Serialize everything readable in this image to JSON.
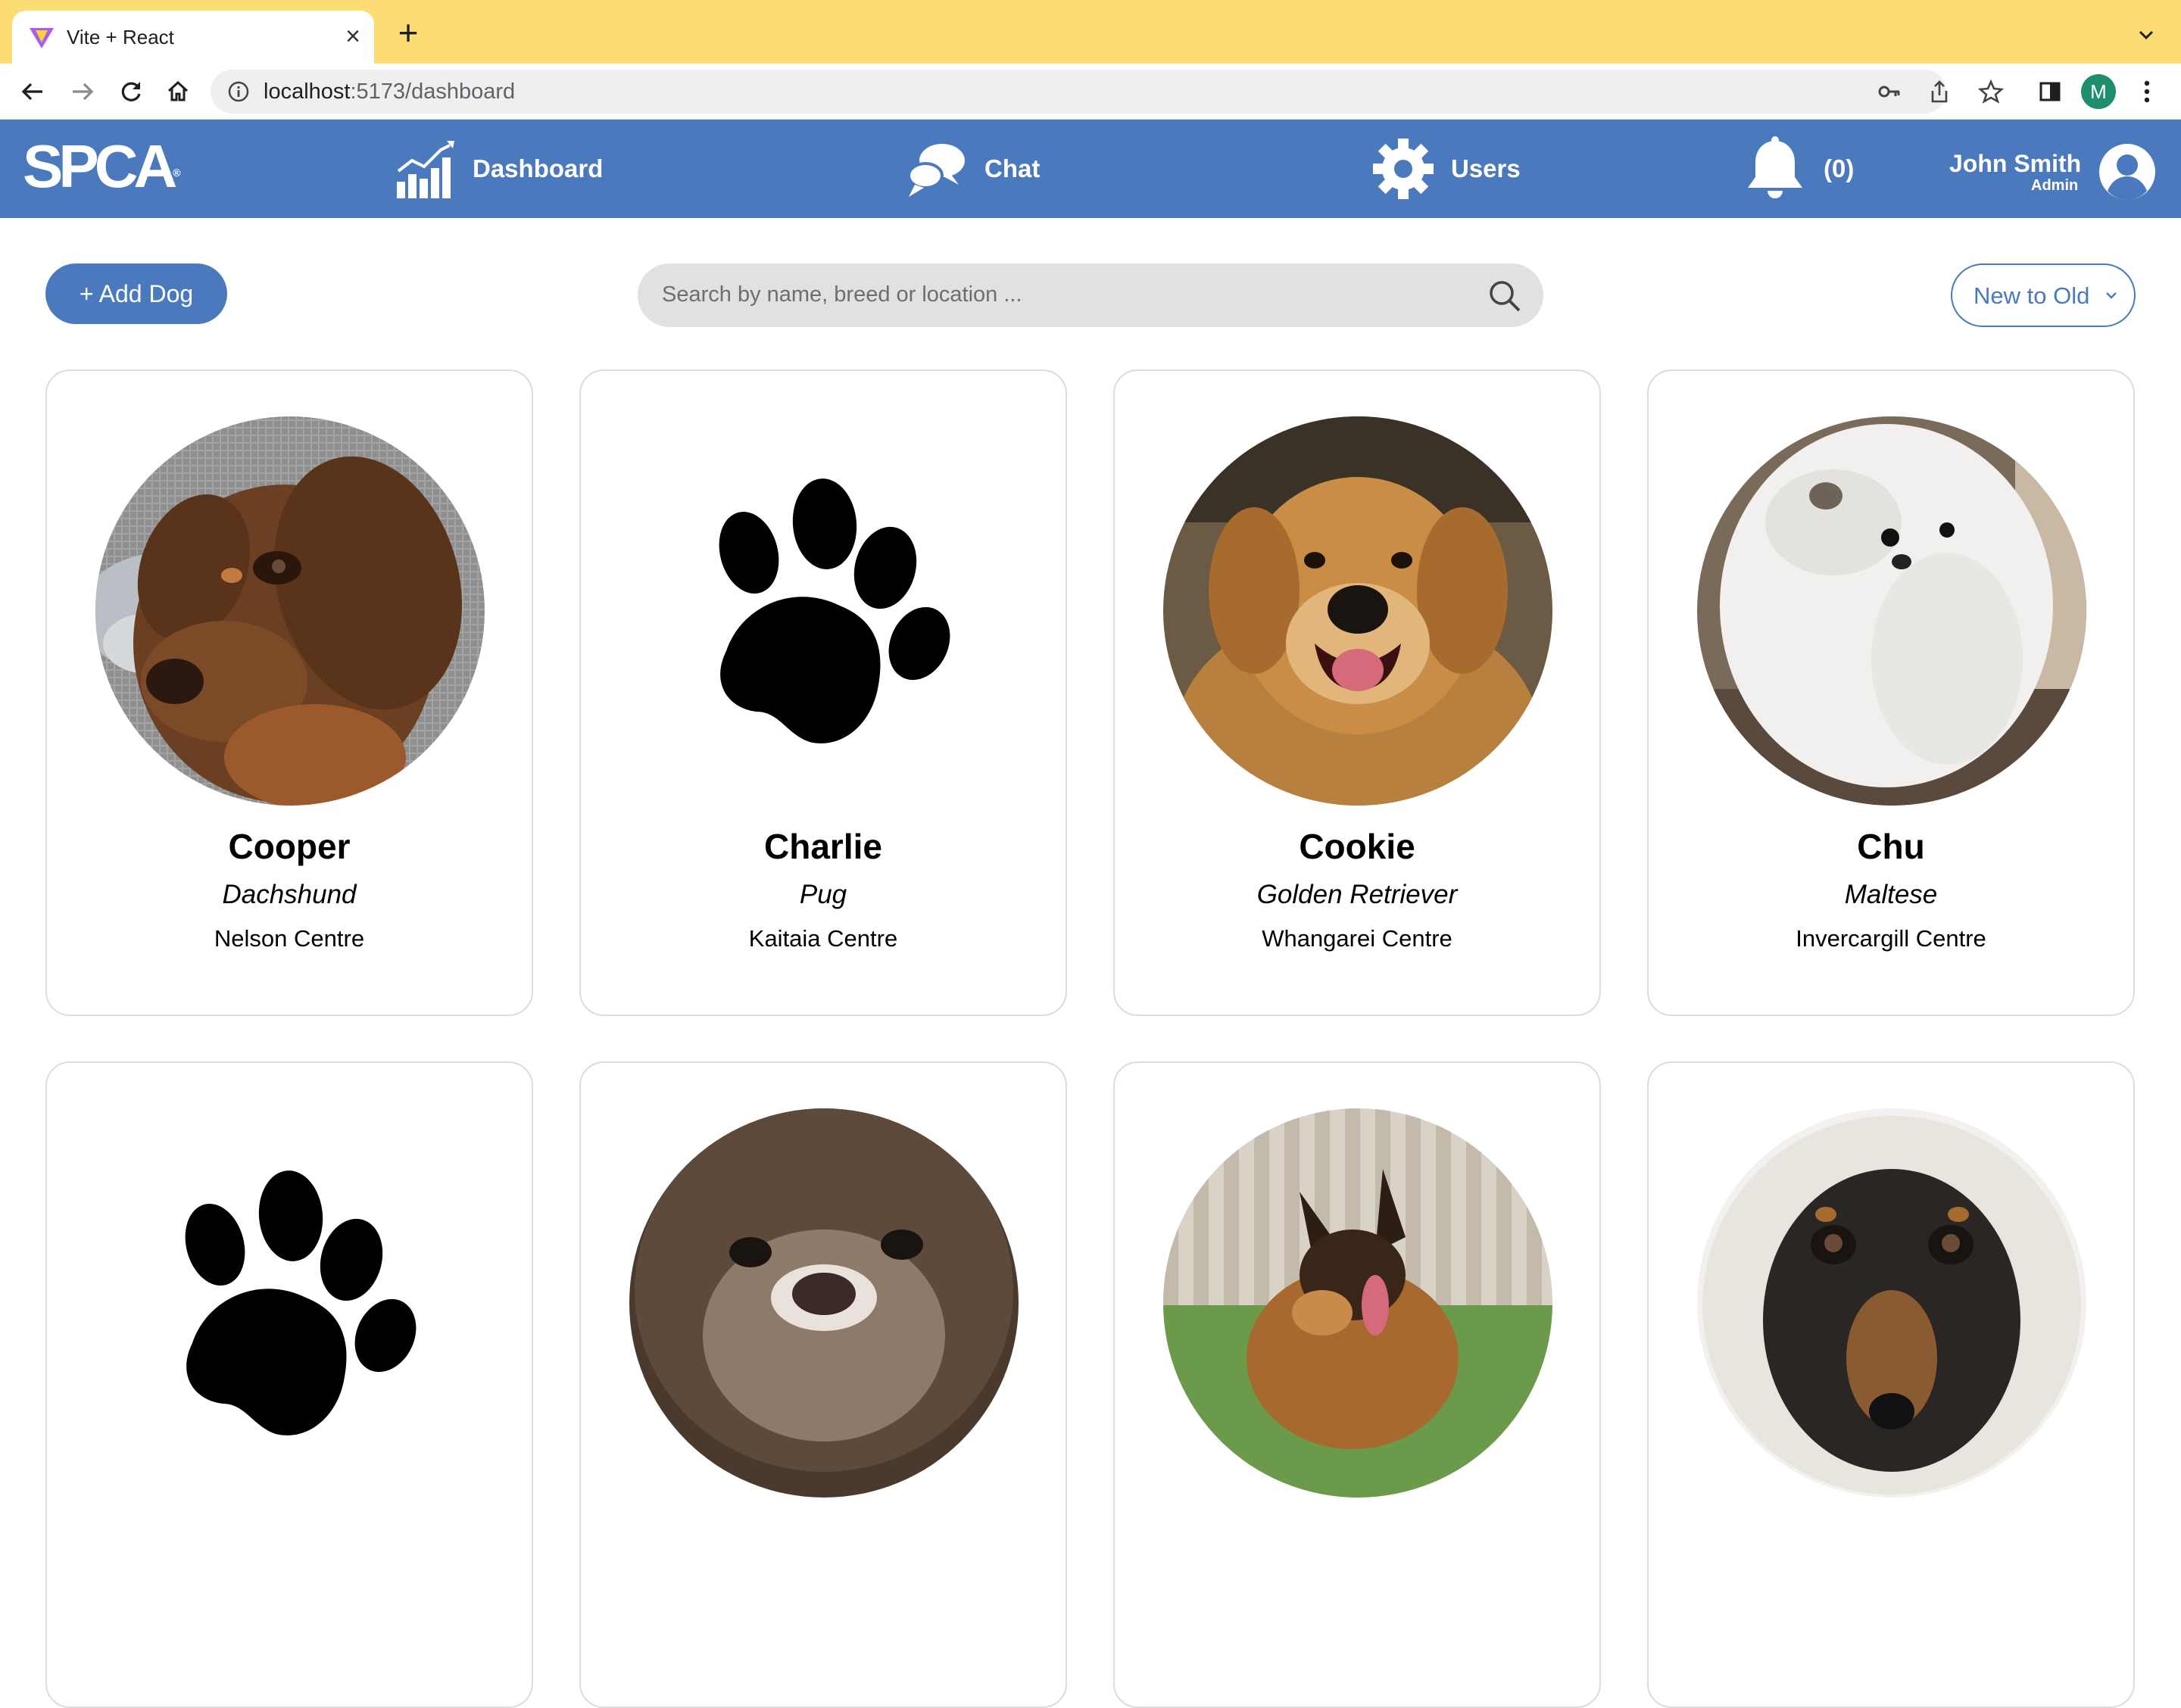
{
  "browser": {
    "tab_title": "Vite + React",
    "url_host": "localhost",
    "url_rest": ":5173/dashboard",
    "profile_initial": "M"
  },
  "nav": {
    "logo_text": "SPCA",
    "logo_mark": "®",
    "dashboard_label": "Dashboard",
    "chat_label": "Chat",
    "users_label": "Users",
    "notification_count": "(0)",
    "user_name": "John Smith",
    "user_role": "Admin"
  },
  "controls": {
    "add_dog_label": "+ Add Dog",
    "search_placeholder": "Search by name, breed or location ...",
    "sort_label": "New to Old"
  },
  "colors": {
    "brand": "#4b79be",
    "tabbar": "#fbdd74"
  },
  "dogs": [
    {
      "name": "Cooper",
      "breed": "Dachshund",
      "location": "Nelson Centre",
      "photo": "dachshund-photo"
    },
    {
      "name": "Charlie",
      "breed": "Pug",
      "location": "Kaitaia Centre",
      "photo": "paw-placeholder"
    },
    {
      "name": "Cookie",
      "breed": "Golden Retriever",
      "location": "Whangarei Centre",
      "photo": "golden-retriever-photo"
    },
    {
      "name": "Chu",
      "breed": "Maltese",
      "location": "Invercargill Centre",
      "photo": "maltese-photo"
    },
    {
      "name": "",
      "breed": "",
      "location": "",
      "photo": "paw-placeholder"
    },
    {
      "name": "",
      "breed": "",
      "location": "",
      "photo": "fluffy-dog-photo"
    },
    {
      "name": "",
      "breed": "",
      "location": "",
      "photo": "german-shepherd-photo"
    },
    {
      "name": "",
      "breed": "",
      "location": "",
      "photo": "dachshund-hoodie-photo"
    }
  ]
}
